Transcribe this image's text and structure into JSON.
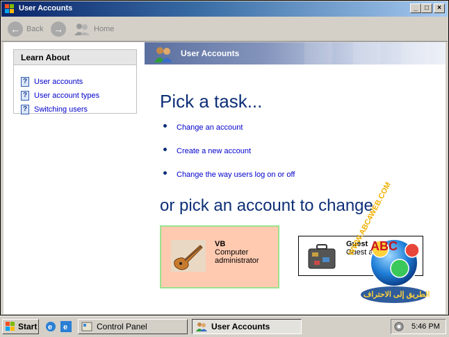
{
  "window": {
    "title": "User Accounts",
    "controls": {
      "minimize": "_",
      "maximize": "□",
      "close": "×"
    }
  },
  "toolbar": {
    "back_label": "Back",
    "forward_icon": "forward-arrow-icon",
    "home_label": "Home"
  },
  "learn_about": {
    "title": "Learn About",
    "items": [
      {
        "label": "User accounts",
        "icon": "help-icon"
      },
      {
        "label": "User account types",
        "icon": "help-icon"
      },
      {
        "label": "Switching users",
        "icon": "help-icon"
      }
    ]
  },
  "banner": {
    "title": "User Accounts",
    "icon": "user-accounts-icon"
  },
  "tasks": {
    "heading": "Pick a task...",
    "items": [
      {
        "label": "Change an account"
      },
      {
        "label": "Create a new account"
      },
      {
        "label": "Change the way users log on or off"
      }
    ]
  },
  "accounts": {
    "heading": "or pick an account to change",
    "items": [
      {
        "name": "VB",
        "line1": "Computer",
        "line2": "administrator",
        "icon": "guitar-icon"
      },
      {
        "name": "Guest",
        "line1": "Guest account is off",
        "icon": "suitcase-icon"
      }
    ]
  },
  "watermark": {
    "url_text": "WWW.ABC4WEB.COM",
    "logo_letters": "ABC",
    "arabic_text": "الطريق إلى الاحتراف"
  },
  "taskbar": {
    "start_label": "Start",
    "quick_launch": [
      "ie-icon",
      "ie-icon-2",
      "desktop-icon"
    ],
    "tasks": [
      {
        "label": "Control Panel",
        "active": false
      },
      {
        "label": "User Accounts",
        "active": true
      }
    ],
    "clock": "5:46 PM"
  },
  "colors": {
    "title_gradient_start": "#0a246a",
    "heading_blue": "#0e2f77",
    "link_blue": "#0000cc",
    "selected_account_bg": "#ffcab0",
    "selected_account_border": "#9be28f"
  }
}
